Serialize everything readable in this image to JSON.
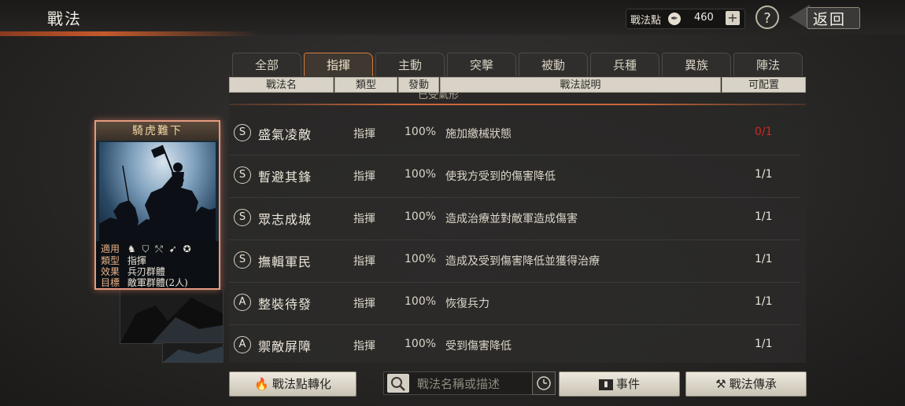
{
  "header": {
    "title": "戰法",
    "points_label": "戰法點",
    "points_value": "460",
    "plus_label": "+",
    "help_label": "?",
    "back_label": "返回"
  },
  "tabs": [
    {
      "label": "全部"
    },
    {
      "label": "指揮",
      "active": true
    },
    {
      "label": "主動"
    },
    {
      "label": "突擊"
    },
    {
      "label": "被動"
    },
    {
      "label": "兵種"
    },
    {
      "label": "異族"
    },
    {
      "label": "陣法"
    }
  ],
  "columns": {
    "name": "戰法名",
    "type": "類型",
    "rate": "發動",
    "desc": "戰法説明",
    "slot": "可配置"
  },
  "partial_row_text": "已受氣形",
  "skills": [
    {
      "rank": "S",
      "name": "盛氣凌敵",
      "type": "指揮",
      "rate": "100%",
      "desc": "施加繳械狀態",
      "slot": "0/1",
      "slot_alert": true
    },
    {
      "rank": "S",
      "name": "暫避其鋒",
      "type": "指揮",
      "rate": "100%",
      "desc": "使我方受到的傷害降低",
      "slot": "1/1"
    },
    {
      "rank": "S",
      "name": "眾志成城",
      "type": "指揮",
      "rate": "100%",
      "desc": "造成治療並對敵軍造成傷害",
      "slot": "1/1"
    },
    {
      "rank": "S",
      "name": "撫輯軍民",
      "type": "指揮",
      "rate": "100%",
      "desc": "造成及受到傷害降低並獲得治療",
      "slot": "1/1"
    },
    {
      "rank": "A",
      "name": "整裝待發",
      "type": "指揮",
      "rate": "100%",
      "desc": "恢復兵力",
      "slot": "1/1"
    },
    {
      "rank": "A",
      "name": "禦敵屏障",
      "type": "指揮",
      "rate": "100%",
      "desc": "受到傷害降低",
      "slot": "1/1"
    }
  ],
  "card": {
    "title": "騎虎難下",
    "applies_label": "適用",
    "type_label": "類型",
    "type_value": "指揮",
    "effect_label": "效果",
    "effect_value": "兵刃群體",
    "target_label": "目標",
    "target_value": "敵軍群體(2人)",
    "unit_icons": [
      "cavalry-icon",
      "shield-icon",
      "archer-icon",
      "spear-icon",
      "chariot-icon"
    ]
  },
  "bottom": {
    "convert_label": "戰法點轉化",
    "search_placeholder": "戰法名稱或描述",
    "event_label": "事件",
    "inherit_label": "戰法傳承"
  },
  "colors": {
    "accent": "#d87a3a",
    "alert_red": "#c82a22",
    "card_border": "#e59b80"
  }
}
